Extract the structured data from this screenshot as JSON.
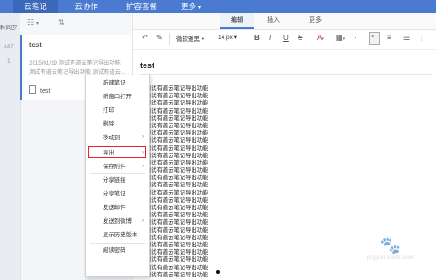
{
  "topnav": {
    "tabs": [
      {
        "label": "云笔记",
        "active": true
      },
      {
        "label": "云协作",
        "active": false
      },
      {
        "label": "扩容套餐",
        "active": false
      },
      {
        "label": "更多",
        "active": false
      }
    ],
    "more_caret": "▾"
  },
  "left_strip": {
    "sync_label": "料同步",
    "count": "337",
    "row_number": "1"
  },
  "note": {
    "title": "test",
    "meta_line1": "2015/01/19  测试有道云笔记导出功能",
    "meta_line2": "测试有道云笔记导出功能 测试有道云...",
    "attachment": "test"
  },
  "editor": {
    "tabs": [
      {
        "label": "编辑",
        "active": true
      },
      {
        "label": "插入",
        "active": false
      },
      {
        "label": "更多",
        "active": false
      }
    ],
    "font_family": "微软雅黑",
    "font_size": "14 px",
    "title": "test",
    "body_lines": [
      "测试有道云笔记导出功能",
      "测试有道云笔记导出功能",
      "测试有道云笔记导出功能",
      "测试有道云笔记导出功能",
      "测试有道云笔记导出功能",
      "测试有道云笔记导出功能",
      "测试有道云笔记导出功能",
      "测试有道云笔记导出功能",
      "测试有道云笔记导出功能",
      "测试有道云笔记导出功能",
      "测试有道云笔记导出功能",
      "测试有道云笔记导出功能",
      "测试有道云笔记导出功能",
      "测试有道云笔记导出功能",
      "测试有道云笔记导出功能",
      "测试有道云笔记导出功能",
      "测试有道云笔记导出功能",
      "测试有道云笔记导出功能",
      "测试有道云笔记导出功能",
      "测试有道云笔记导出功能",
      "测试有道云笔记导出功能",
      "测试有道云笔记导出功能",
      "测试有道云笔记导出功能",
      "测试有道云笔记导出功能",
      "测试有道云笔记导出功能",
      "测试有道云笔记导出功能"
    ]
  },
  "context_menu": {
    "items": [
      {
        "label": "新建笔记"
      },
      {
        "label": "新窗口打开"
      },
      {
        "label": "打印"
      },
      {
        "label": "删除"
      },
      {
        "label": "移动到",
        "submenu": true
      },
      {
        "label": "导出",
        "submenu": true,
        "highlighted": true
      },
      {
        "label": "保存附件",
        "submenu": true
      },
      {
        "label": "分享链接"
      },
      {
        "label": "分享笔记"
      },
      {
        "label": "发送邮件"
      },
      {
        "label": "发送到微博",
        "submenu": true
      },
      {
        "label": "显示历史版本"
      },
      {
        "label": "阅读密码"
      }
    ],
    "submenu_arrow": "›"
  },
  "watermark": {
    "text": "jingyan.baidu.com"
  },
  "colors": {
    "nav_blue": "#4a7bd0",
    "highlight_red": "#e0262b"
  }
}
